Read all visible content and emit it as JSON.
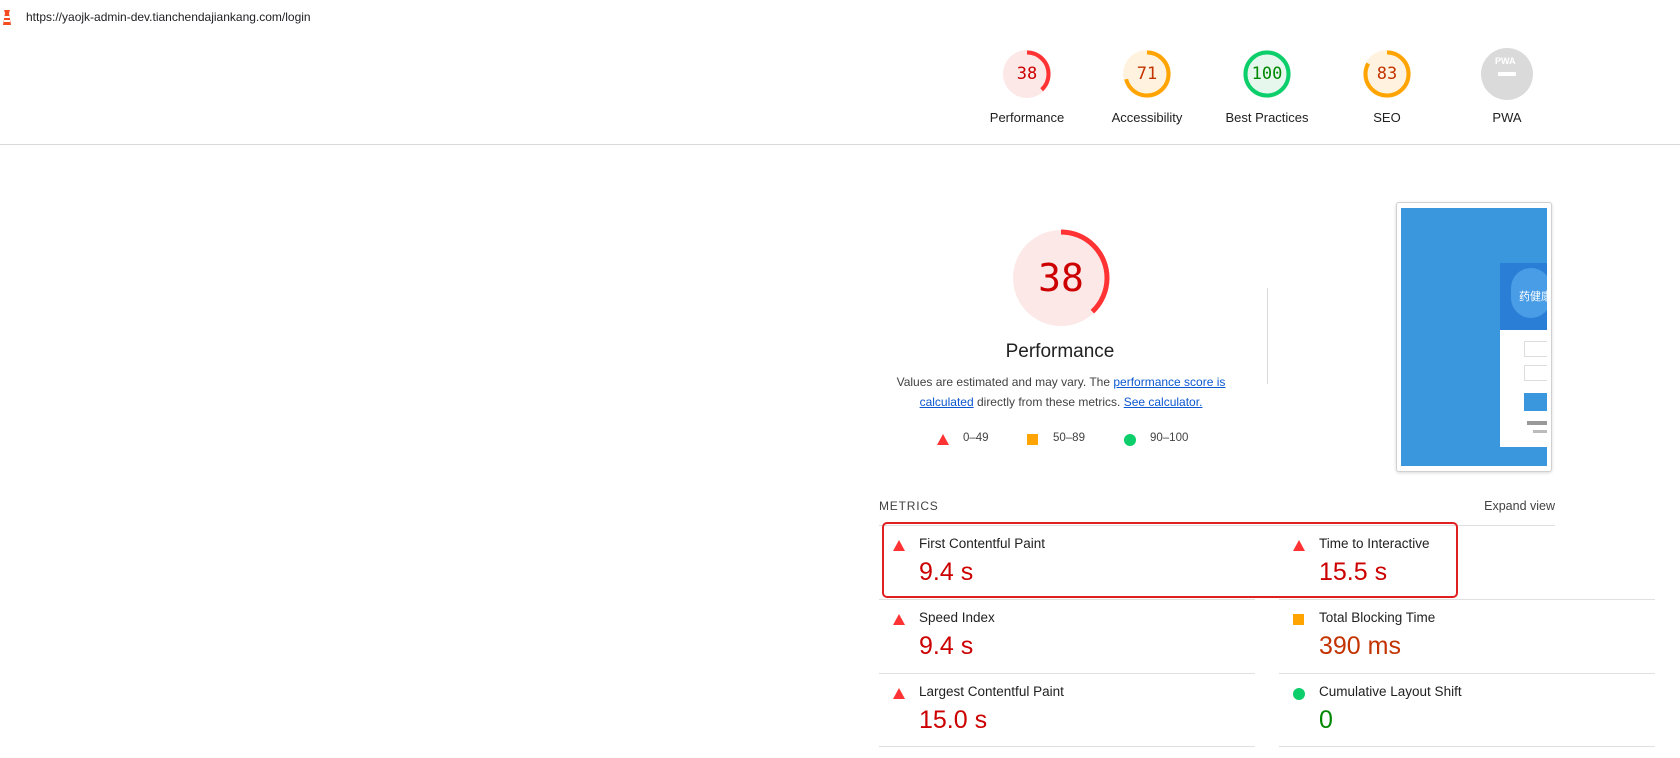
{
  "browser": {
    "url": "https://yaojk-admin-dev.tianchendajiankang.com/login"
  },
  "category_nav": [
    {
      "label": "Performance",
      "score": "38",
      "fraction": 0.38,
      "color": "#ff3333",
      "text_color": "#c00",
      "bg": "#fde8e8"
    },
    {
      "label": "Accessibility",
      "score": "71",
      "fraction": 0.71,
      "color": "#ffa400",
      "text_color": "#c33300",
      "bg": "#fff3e0"
    },
    {
      "label": "Best Practices",
      "score": "100",
      "fraction": 1.0,
      "color": "#0cce6b",
      "text_color": "#080",
      "bg": "#e6f8ee"
    },
    {
      "label": "SEO",
      "score": "83",
      "fraction": 0.83,
      "color": "#ffa400",
      "text_color": "#c33300",
      "bg": "#fff3e0"
    },
    {
      "label": "PWA",
      "score": "",
      "badge_text": "PWA",
      "color": "#dadada"
    }
  ],
  "performance": {
    "score": "38",
    "fraction": 0.38,
    "title": "Performance",
    "desc_prefix": "Values are estimated and may vary. The ",
    "desc_link": "performance score is calculated",
    "desc_middle": " directly from these metrics. ",
    "desc_link2": "See calculator.",
    "legend": [
      {
        "shape": "triangle-icon",
        "label": "0–49",
        "color": "#ff3333"
      },
      {
        "shape": "square-icon",
        "label": "50–89",
        "color": "#ffa400"
      },
      {
        "shape": "circle-icon",
        "label": "90–100",
        "color": "#0cce6b"
      }
    ],
    "screenshot_title": "药健康"
  },
  "metrics": {
    "heading": "METRICS",
    "expand_label": "Expand view",
    "items": [
      {
        "title": "First Contentful Paint",
        "value": "9.4 s",
        "rating": "fail",
        "color": "#c00"
      },
      {
        "title": "Time to Interactive",
        "value": "15.5 s",
        "rating": "fail",
        "color": "#c00"
      },
      {
        "title": "Speed Index",
        "value": "9.4 s",
        "rating": "fail",
        "color": "#c00"
      },
      {
        "title": "Total Blocking Time",
        "value": "390 ms",
        "rating": "average",
        "color": "#c33300"
      },
      {
        "title": "Largest Contentful Paint",
        "value": "15.0 s",
        "rating": "fail",
        "color": "#c00"
      },
      {
        "title": "Cumulative Layout Shift",
        "value": "0",
        "rating": "pass",
        "color": "#080"
      }
    ]
  }
}
